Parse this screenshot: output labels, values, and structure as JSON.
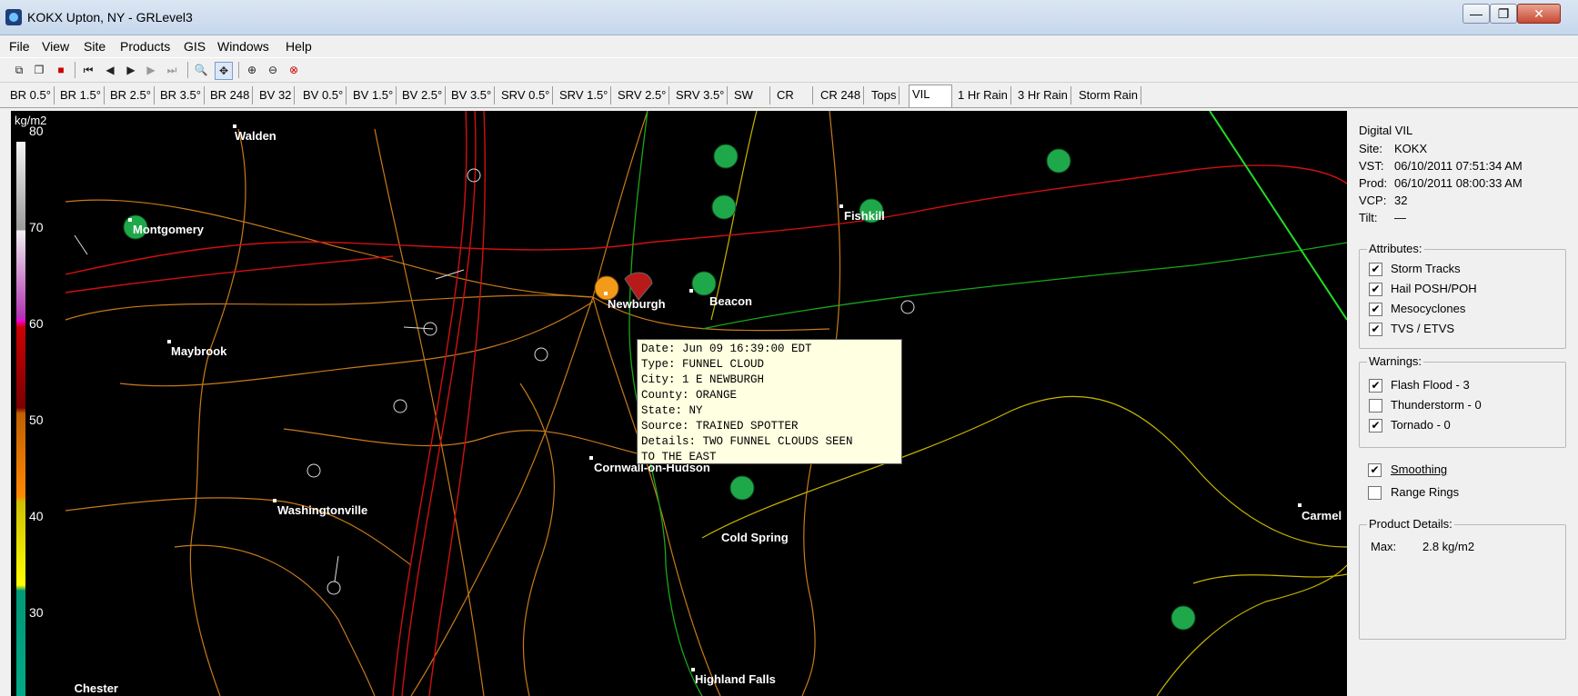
{
  "window": {
    "title": "KOKX Upton, NY - GRLevel3",
    "min": "—",
    "max": "❐",
    "close": "✕"
  },
  "menu": [
    "File",
    "View",
    "Site",
    "Products",
    "GIS",
    "Windows",
    "Help"
  ],
  "toolbar_icons": [
    "copy-icon",
    "duplicate-icon",
    "stop-icon",
    "first-frame-icon",
    "prev-frame-icon",
    "play-icon",
    "next-frame-icon",
    "last-frame-icon",
    "zoom-icon",
    "pan-icon",
    "zoom-in-icon",
    "zoom-out-icon",
    "zoom-reset-icon"
  ],
  "tabs": [
    "BR 0.5°",
    "BR 1.5°",
    "BR 2.5°",
    "BR 3.5°",
    "BR 248",
    "BV 32",
    "BV 0.5°",
    "BV 1.5°",
    "BV 2.5°",
    "BV 3.5°",
    "SRV 0.5°",
    "SRV 1.5°",
    "SRV 2.5°",
    "SRV 3.5°",
    "SW",
    "CR",
    "CR 248",
    "Tops",
    "VIL",
    "1 Hr Rain",
    "3 Hr Rain",
    "Storm Rain"
  ],
  "active_tab": "VIL",
  "legend": {
    "unit": "kg/m2",
    "labels": [
      "80",
      "70",
      "60",
      "50",
      "40",
      "30"
    ]
  },
  "cities": [
    {
      "name": "Walden"
    },
    {
      "name": "Montgomery"
    },
    {
      "name": "Maybrook"
    },
    {
      "name": "Newburgh"
    },
    {
      "name": "Beacon"
    },
    {
      "name": "Fishkill"
    },
    {
      "name": "Cornwall-on-Hudson"
    },
    {
      "name": "Washingtonville"
    },
    {
      "name": "Cold Spring"
    },
    {
      "name": "Carmel"
    },
    {
      "name": "Highland Falls"
    },
    {
      "name": "Chester"
    }
  ],
  "report_tooltip": {
    "lines": [
      "Date: Jun 09 16:39:00 EDT",
      "Type: FUNNEL CLOUD",
      "City: 1 E NEWBURGH",
      "County: ORANGE",
      "State: NY",
      "Source: TRAINED SPOTTER",
      "Details: TWO FUNNEL CLOUDS SEEN",
      "TO THE EAST"
    ]
  },
  "panel": {
    "product": "Digital VIL",
    "site_label": "Site:",
    "site": "KOKX",
    "vst_label": "VST:",
    "vst": "06/10/2011  07:51:34 AM",
    "prod_label": "Prod:",
    "prod": "06/10/2011  08:00:33 AM",
    "vcp_label": "VCP:",
    "vcp": "32",
    "tilt_label": "Tilt:",
    "tilt": "—",
    "attributes_title": "Attributes:",
    "attributes": [
      {
        "label": "Storm Tracks",
        "checked": true
      },
      {
        "label": "Hail POSH/POH",
        "checked": true
      },
      {
        "label": "Mesocyclones",
        "checked": true
      },
      {
        "label": "TVS / ETVS",
        "checked": true
      }
    ],
    "warnings_title": "Warnings:",
    "warnings": [
      {
        "label": "Flash Flood - 3",
        "checked": true
      },
      {
        "label": "Thunderstorm - 0",
        "checked": false
      },
      {
        "label": "Tornado - 0",
        "checked": true
      }
    ],
    "options": [
      {
        "label": "Smoothing",
        "checked": true
      },
      {
        "label": "Range Rings",
        "checked": false
      }
    ],
    "details_title": "Product Details:",
    "max_label": "Max:",
    "max_value": "2.8 kg/m2"
  }
}
